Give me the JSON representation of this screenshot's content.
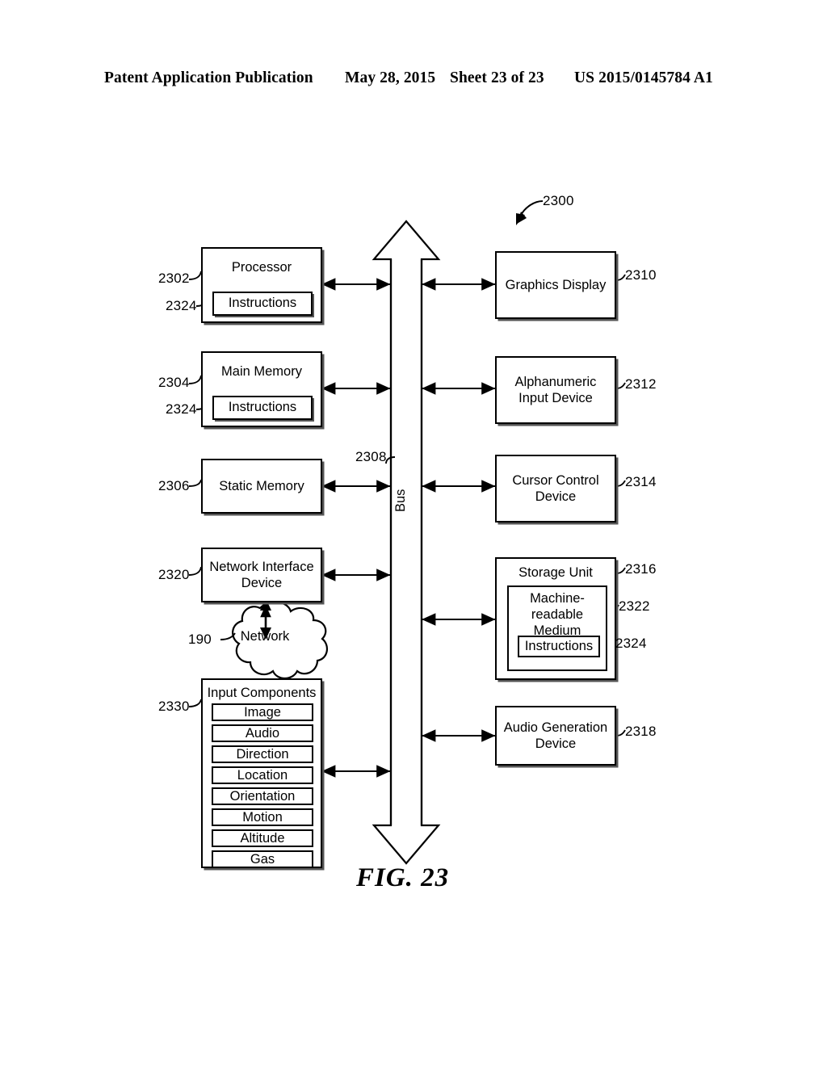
{
  "header": {
    "publication": "Patent Application Publication",
    "date": "May 28, 2015",
    "sheet": "Sheet 23 of 23",
    "patent_number": "US 2015/0145784 A1"
  },
  "figure": {
    "caption": "FIG. 23",
    "system_ref": "2300",
    "bus": {
      "label": "Bus",
      "ref": "2308"
    },
    "network": {
      "label": "Network",
      "ref": "190"
    }
  },
  "left_column": [
    {
      "id": "processor",
      "title": "Processor",
      "ref": "2302",
      "inner": {
        "label": "Instructions",
        "ref": "2324"
      }
    },
    {
      "id": "main-memory",
      "title": "Main Memory",
      "ref": "2304",
      "inner": {
        "label": "Instructions",
        "ref": "2324"
      }
    },
    {
      "id": "static-memory",
      "title": "Static Memory",
      "ref": "2306",
      "inner": null
    },
    {
      "id": "network-interface-device",
      "title": "Network Interface Device",
      "ref": "2320",
      "inner": null
    },
    {
      "id": "input-components",
      "title": "Input Components",
      "ref": "2330",
      "items": [
        "Image",
        "Audio",
        "Direction",
        "Location",
        "Orientation",
        "Motion",
        "Altitude",
        "Gas"
      ]
    }
  ],
  "right_column": [
    {
      "id": "graphics-display",
      "title": "Graphics Display",
      "ref": "2310"
    },
    {
      "id": "alphanumeric-input-device",
      "title": "Alphanumeric Input Device",
      "ref": "2312"
    },
    {
      "id": "cursor-control-device",
      "title": "Cursor Control Device",
      "ref": "2314"
    },
    {
      "id": "storage-unit",
      "title": "Storage Unit",
      "ref": "2316",
      "medium": {
        "label": "Machine-readable Medium",
        "ref": "2322"
      },
      "instructions": {
        "label": "Instructions",
        "ref": "2324"
      }
    },
    {
      "id": "audio-generation-device",
      "title": "Audio Generation Device",
      "ref": "2318"
    }
  ],
  "colors": {
    "ink": "#000000",
    "paper": "#ffffff",
    "shadow": "#555555"
  }
}
